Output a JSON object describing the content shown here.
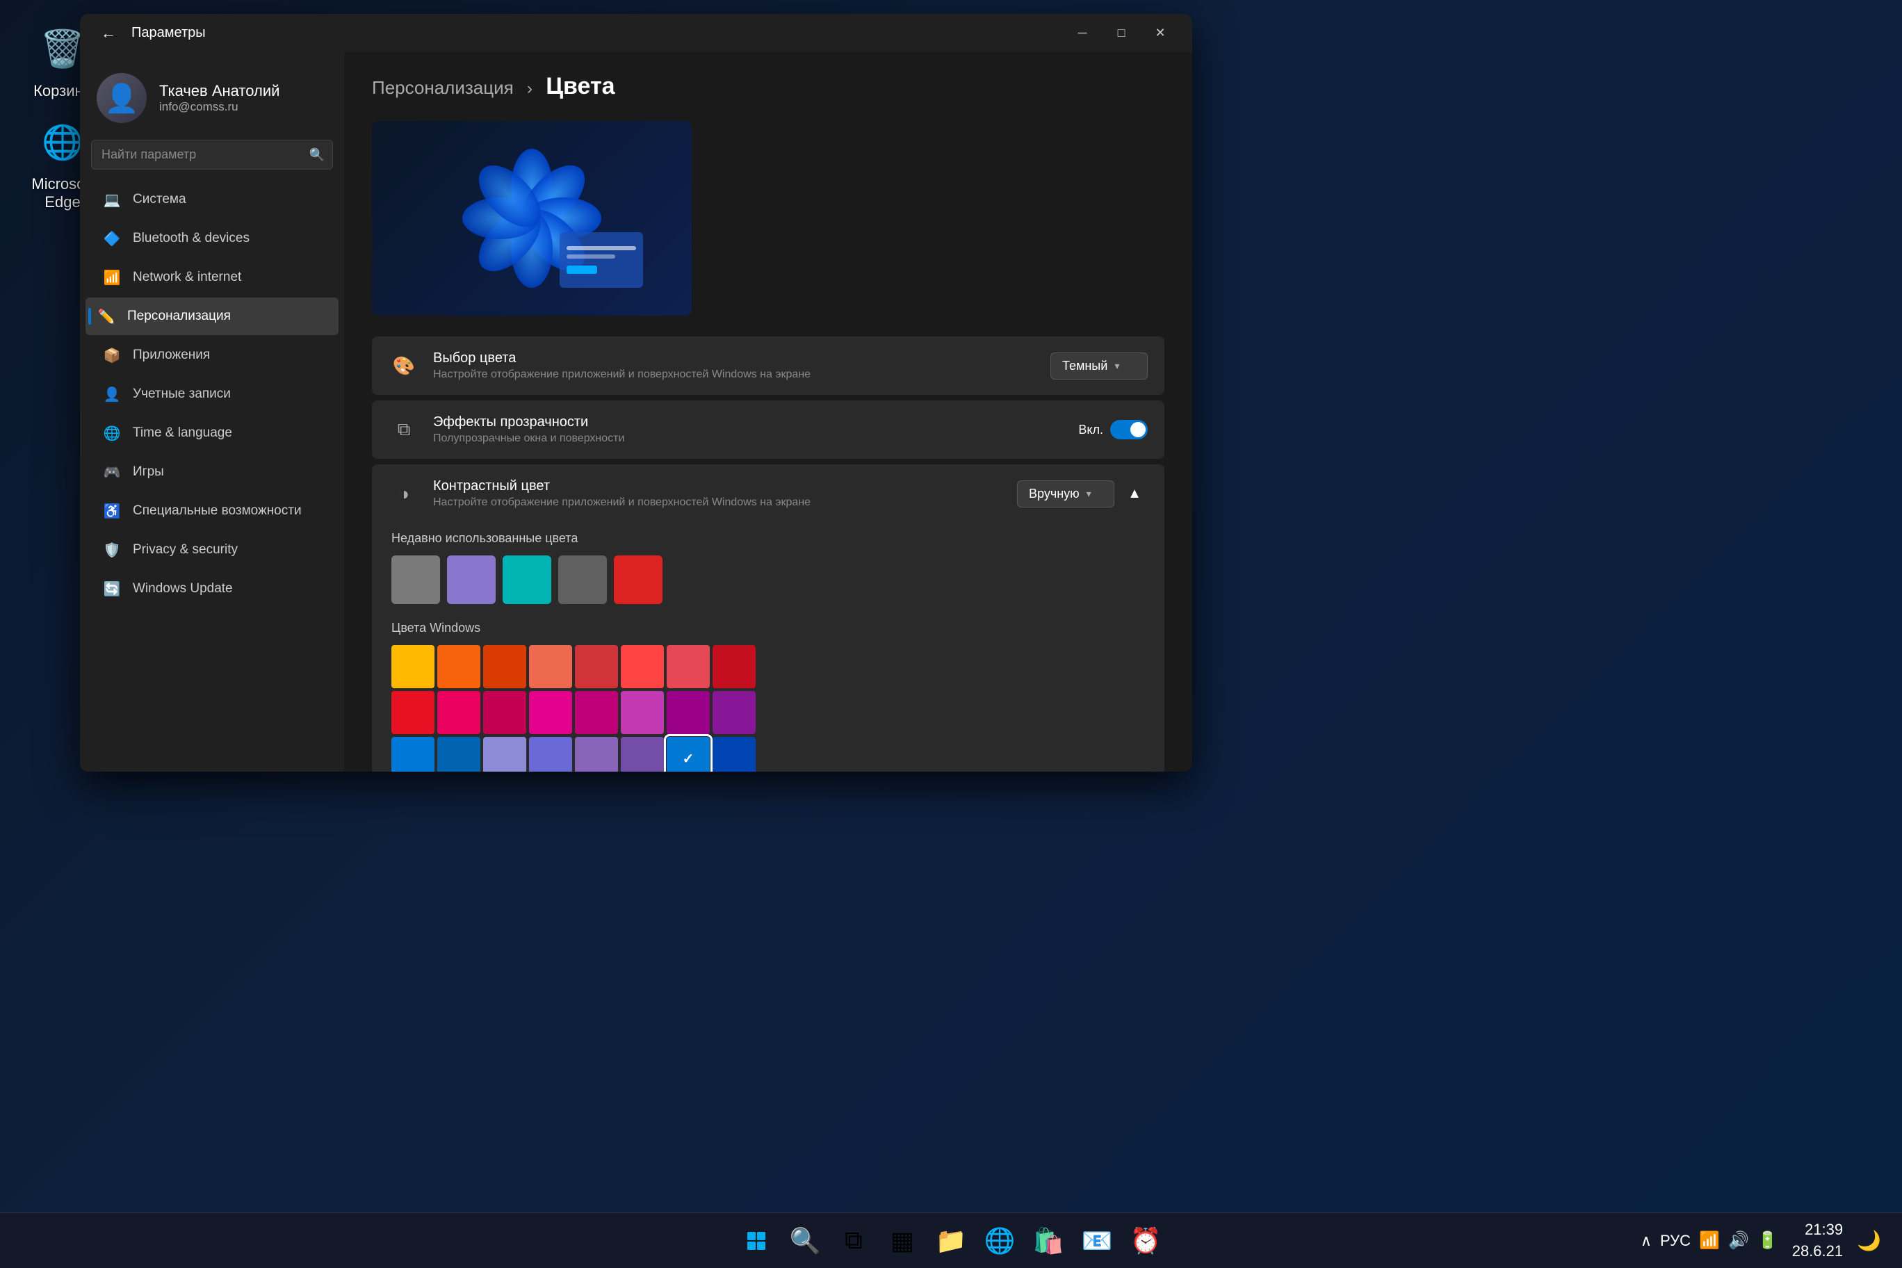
{
  "desktop": {
    "background": "#0a1628",
    "icons": [
      {
        "id": "recycle-bin",
        "label": "Корзина",
        "emoji": "🗑️"
      },
      {
        "id": "edge",
        "label": "Microsoft Edge",
        "emoji": "🌐"
      }
    ]
  },
  "taskbar": {
    "time": "21:39",
    "date": "28.6.21",
    "language": "РУС",
    "icons": [
      {
        "id": "start",
        "emoji": "⊞"
      },
      {
        "id": "search",
        "emoji": "🔍"
      },
      {
        "id": "task-view",
        "emoji": "⧉"
      },
      {
        "id": "widgets",
        "emoji": "▦"
      },
      {
        "id": "file-explorer",
        "emoji": "📁"
      },
      {
        "id": "edge-taskbar",
        "emoji": "🌐"
      },
      {
        "id": "store",
        "emoji": "🛍️"
      },
      {
        "id": "mail",
        "emoji": "📧"
      },
      {
        "id": "clock",
        "emoji": "⏰"
      }
    ]
  },
  "window": {
    "title": "Параметры",
    "back_button": "←",
    "controls": {
      "minimize": "─",
      "maximize": "□",
      "close": "✕"
    }
  },
  "sidebar": {
    "user": {
      "name": "Ткачев Анатолий",
      "email": "info@comss.ru"
    },
    "search": {
      "placeholder": "Найти параметр"
    },
    "nav_items": [
      {
        "id": "system",
        "label": "Система",
        "icon": "💻",
        "active": false
      },
      {
        "id": "bluetooth",
        "label": "Bluetooth & devices",
        "icon": "🔷",
        "active": false
      },
      {
        "id": "network",
        "label": "Network & internet",
        "icon": "📶",
        "active": false
      },
      {
        "id": "personalization",
        "label": "Персонализация",
        "icon": "✏️",
        "active": true
      },
      {
        "id": "apps",
        "label": "Приложения",
        "icon": "📦",
        "active": false
      },
      {
        "id": "accounts",
        "label": "Учетные записи",
        "icon": "👤",
        "active": false
      },
      {
        "id": "time",
        "label": "Time & language",
        "icon": "🌐",
        "active": false
      },
      {
        "id": "gaming",
        "label": "Игры",
        "icon": "🎮",
        "active": false
      },
      {
        "id": "accessibility",
        "label": "Специальные возможности",
        "icon": "♿",
        "active": false
      },
      {
        "id": "privacy",
        "label": "Privacy & security",
        "icon": "🛡️",
        "active": false
      },
      {
        "id": "windows-update",
        "label": "Windows Update",
        "icon": "🔄",
        "active": false
      }
    ]
  },
  "content": {
    "breadcrumb_parent": "Персонализация",
    "breadcrumb_separator": "›",
    "breadcrumb_current": "Цвета",
    "rows": [
      {
        "id": "color-choice",
        "icon": "🎨",
        "title": "Выбор цвета",
        "desc": "Настройте отображение приложений и поверхностей Windows на экране",
        "control_type": "dropdown",
        "control_value": "Темный"
      },
      {
        "id": "transparency",
        "icon": "⧉",
        "title": "Эффекты прозрачности",
        "desc": "Полупрозрачные окна и поверхности",
        "control_type": "toggle",
        "control_value": "Вкл.",
        "toggle_on": true
      },
      {
        "id": "contrast",
        "icon": "◑",
        "title": "Контрастный цвет",
        "desc": "Настройте отображение приложений и поверхностей Windows на экране",
        "control_type": "dropdown-expand",
        "control_value": "Вручную",
        "expanded": true
      }
    ],
    "recent_colors_label": "Недавно использованные цвета",
    "recent_colors": [
      "#7a7a7a",
      "#8877cc",
      "#00b4b4",
      "#606060",
      "#dd2222"
    ],
    "windows_colors_label": "Цвета Windows",
    "color_grid": [
      [
        "#ffb900",
        "#f7630c",
        "#da3b01",
        "#ef6950",
        "#d13438",
        "#ff4343",
        "#e74856",
        "#c50f1f"
      ],
      [
        "#e81123",
        "#ea005e",
        "#c30052",
        "#e3008c",
        "#bf0077",
        "#c239b3",
        "#9a0089",
        "#881798"
      ],
      [
        "#0078d7",
        "#0063b1",
        "#8e8cd8",
        "#6b69d6",
        "#8764b8",
        "#744da9",
        "#b146c2",
        "#881798"
      ],
      [
        "#0099bc",
        "#2d7d9a",
        "#00b7c3",
        "#038387",
        "#00b294",
        "#018574",
        "#00cc6a",
        "#10893e"
      ]
    ],
    "selected_color_index": {
      "row": 0,
      "col": 6
    }
  }
}
